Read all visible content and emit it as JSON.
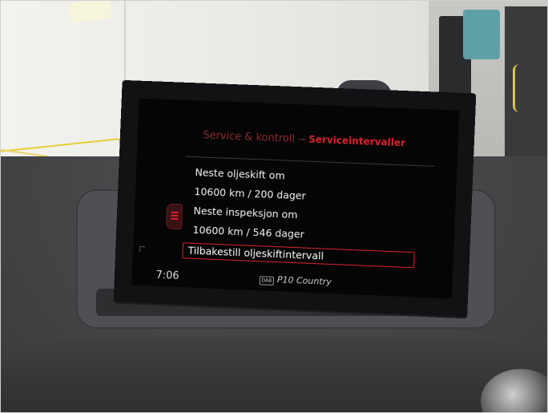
{
  "screen": {
    "breadcrumb": {
      "parent": "Service & kontroll",
      "separator": "⊸",
      "current": "Serviceintervaller"
    },
    "lines": [
      "Neste oljeskift om",
      "10600 km / 200 dager",
      "Neste inspeksjon om",
      "10600 km / 546 dager"
    ],
    "action": "Tilbakestill oljeskiftintervall",
    "status": {
      "time": "7:06",
      "dab_badge": "DAB",
      "station": "P10 Country"
    }
  },
  "colors": {
    "accent": "#d8242d",
    "accent_dim": "#8b2b32",
    "text": "#f4f4f4",
    "screen_bg": "#050505"
  },
  "icons": [
    "scroll-tab-icon"
  ]
}
